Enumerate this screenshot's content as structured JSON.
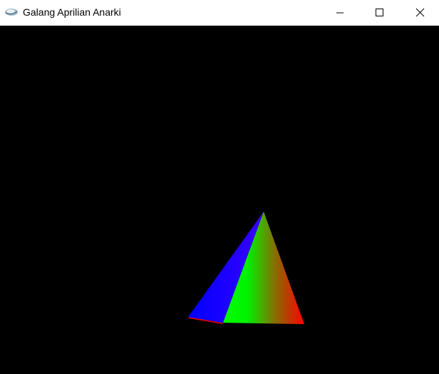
{
  "window": {
    "title": "Galang Aprilian Anarki",
    "app_icon": "opengl-glut-icon",
    "controls": [
      "minimize",
      "maximize",
      "close"
    ]
  },
  "scene": {
    "background": "#000000",
    "object": "pyramid",
    "face_colors": {
      "left_face": [
        "#0000ff",
        "#3b00ff"
      ],
      "front_face": [
        "#00ff00",
        "#ff0000"
      ],
      "base_edge": "#ff0000"
    }
  }
}
